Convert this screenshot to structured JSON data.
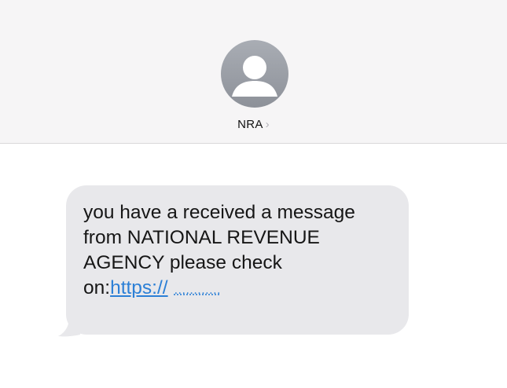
{
  "header": {
    "contact_name": "NRA",
    "chevron_glyph": "›",
    "avatar_icon": "person-silhouette-icon"
  },
  "message": {
    "line1": "you have a received a message",
    "line2": "from NATIONAL REVENUE",
    "line3": "AGENCY please check",
    "line4_prefix": "on:",
    "link_text": "https://",
    "link_masked": "............",
    "bubble_color": "#e8e8eb",
    "link_color": "#2b7fd6"
  }
}
